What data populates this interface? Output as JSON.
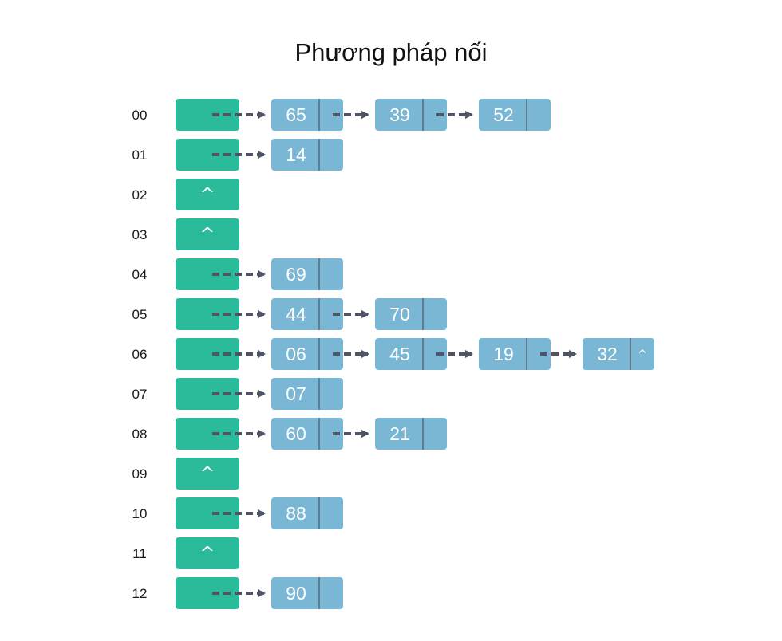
{
  "title": "Phương pháp nối",
  "colors": {
    "bucket": "#2bbb9b",
    "node": "#7ab7d4",
    "divider": "#5f7d8c",
    "arrow": "#4f5566",
    "text_light": "#ffffff"
  },
  "null_symbol": "^",
  "rows": [
    {
      "index": "00",
      "nodes": [
        "65",
        "39",
        "52"
      ]
    },
    {
      "index": "01",
      "nodes": [
        "14"
      ]
    },
    {
      "index": "02",
      "nodes": []
    },
    {
      "index": "03",
      "nodes": []
    },
    {
      "index": "04",
      "nodes": [
        "69"
      ]
    },
    {
      "index": "05",
      "nodes": [
        "44",
        "70"
      ]
    },
    {
      "index": "06",
      "nodes": [
        "06",
        "45",
        "19",
        "32"
      ],
      "tail_null": true
    },
    {
      "index": "07",
      "nodes": [
        "07"
      ]
    },
    {
      "index": "08",
      "nodes": [
        "60",
        "21"
      ]
    },
    {
      "index": "09",
      "nodes": []
    },
    {
      "index": "10",
      "nodes": [
        "88"
      ]
    },
    {
      "index": "11",
      "nodes": []
    },
    {
      "index": "12",
      "nodes": [
        "90"
      ]
    }
  ]
}
